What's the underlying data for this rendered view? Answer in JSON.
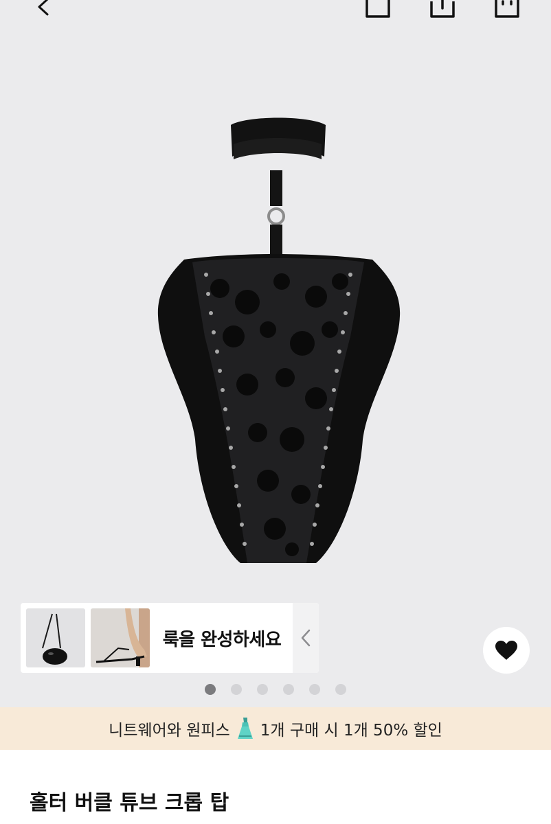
{
  "topbar": {
    "back_icon": "chevron-left-icon",
    "save_icon": "bookmark-icon",
    "share_icon": "share-icon",
    "cart_icon": "shopping-bag-icon"
  },
  "gallery": {
    "complete_the_look": "룩을 완성하세요",
    "dots_count": 6,
    "active_index": 0
  },
  "promo": {
    "text_before": "니트웨어와 원피스",
    "emoji": "dress-emoji",
    "text_after": "1개 구매 시 1개 50% 할인"
  },
  "product": {
    "title": "홀터 버클 튜브 크롭 탑"
  },
  "colors": {
    "hero_bg": "#ebebed",
    "promo_bg": "#f8ead8"
  }
}
